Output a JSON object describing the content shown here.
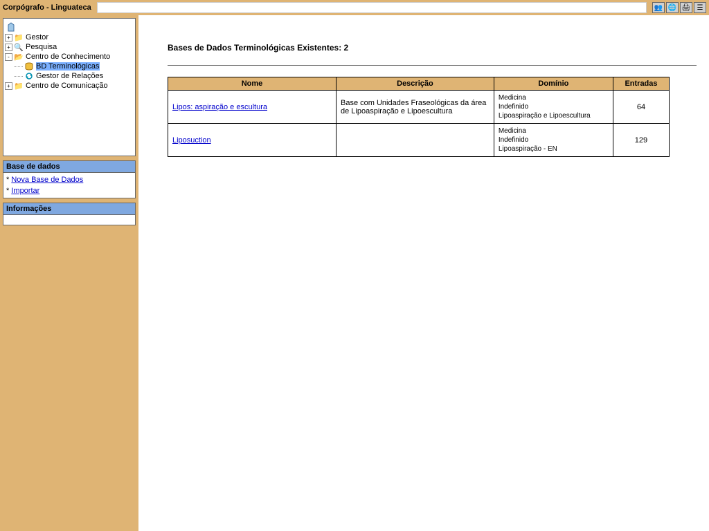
{
  "topbar": {
    "title": "Corpógrafo - Linguateca"
  },
  "tree": {
    "items": [
      {
        "label": "Gestor",
        "icon": "folder",
        "toggle": "+",
        "depth": 0
      },
      {
        "label": "Pesquisa",
        "icon": "search",
        "toggle": "+",
        "depth": 0
      },
      {
        "label": "Centro de Conhecimento",
        "icon": "folder-open",
        "toggle": "-",
        "depth": 0
      },
      {
        "label": "BD Terminológicas",
        "icon": "db",
        "toggle": "",
        "depth": 1,
        "selected": true
      },
      {
        "label": "Gestor de Relações",
        "icon": "refresh",
        "toggle": "",
        "depth": 1
      },
      {
        "label": "Centro de Comunicação",
        "icon": "folder",
        "toggle": "+",
        "depth": 0
      }
    ]
  },
  "side_sections": {
    "db": {
      "header": "Base de dados",
      "links": [
        "Nova Base de Dados",
        "Importar"
      ]
    },
    "info": {
      "header": "Informações"
    }
  },
  "main": {
    "title": "Bases de Dados Terminológicas Existentes: 2",
    "columns": [
      "Nome",
      "Descrição",
      "Domínio",
      "Entradas"
    ],
    "rows": [
      {
        "nome": "Lipos: aspiração e escultura",
        "descricao": "Base com Unidades Fraseológicas da área de Lipoaspiração e Lipoescultura",
        "dominio": [
          "Medicina",
          "Indefinido",
          "Lipoaspiração e Lipoescultura"
        ],
        "entradas": "64"
      },
      {
        "nome": "Liposuction",
        "descricao": "",
        "dominio": [
          "Medicina",
          "Indefinido",
          "Lipoaspiração - EN"
        ],
        "entradas": "129"
      }
    ]
  }
}
